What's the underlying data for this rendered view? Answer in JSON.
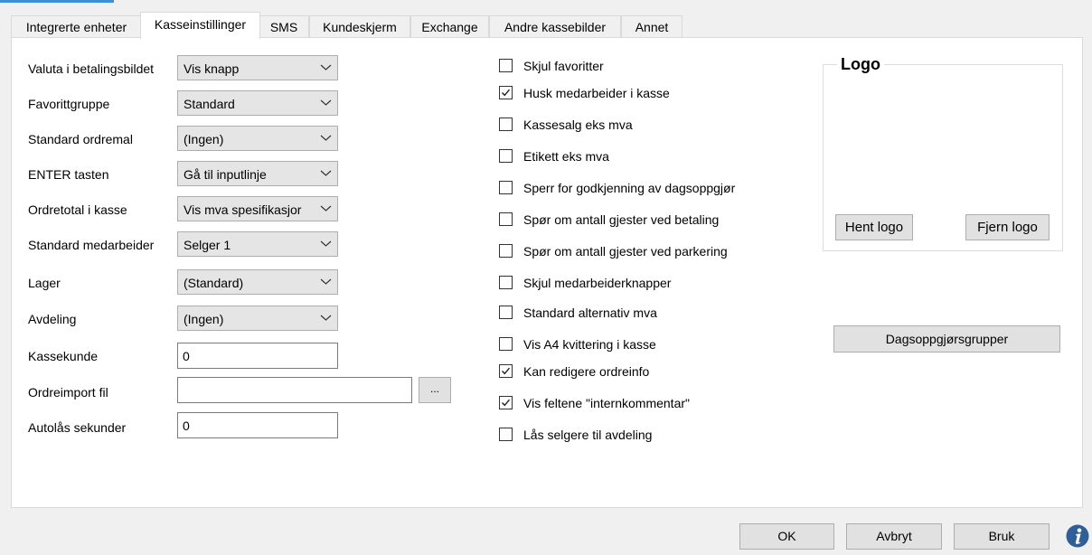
{
  "tabs": [
    {
      "label": "Integrerte enheter"
    },
    {
      "label": "Kasseinstillinger"
    },
    {
      "label": "SMS"
    },
    {
      "label": "Kundeskjerm"
    },
    {
      "label": "Exchange"
    },
    {
      "label": "Andre kassebilder"
    },
    {
      "label": "Annet"
    }
  ],
  "active_tab": "Kasseinstillinger",
  "form": {
    "valuta": {
      "label": "Valuta i betalingsbildet",
      "value": "Vis knapp"
    },
    "favorittgruppe": {
      "label": "Favorittgruppe",
      "value": "Standard"
    },
    "ordremal": {
      "label": "Standard ordremal",
      "value": "(Ingen)"
    },
    "enter": {
      "label": "ENTER tasten",
      "value": "Gå til inputlinje"
    },
    "ordretotal": {
      "label": "Ordretotal i kasse",
      "value": "Vis mva spesifikasjor"
    },
    "medarbeider": {
      "label": "Standard medarbeider",
      "value": "Selger 1"
    },
    "lager": {
      "label": "Lager",
      "value": "(Standard)"
    },
    "avdeling": {
      "label": "Avdeling",
      "value": "(Ingen)"
    },
    "kassekunde": {
      "label": "Kassekunde",
      "value": "0"
    },
    "ordreimport": {
      "label": "Ordreimport fil",
      "value": "",
      "browse_label": "..."
    },
    "autolas": {
      "label": "Autolås sekunder",
      "value": "0"
    }
  },
  "checkboxes": [
    {
      "label": "Skjul favoritter",
      "checked": false
    },
    {
      "label": "Husk medarbeider i kasse",
      "checked": true
    },
    {
      "label": "Kassesalg eks mva",
      "checked": false
    },
    {
      "label": "Etikett eks mva",
      "checked": false
    },
    {
      "label": "Sperr for godkjenning av dagsoppgjør",
      "checked": false
    },
    {
      "label": "Spør om antall gjester ved betaling",
      "checked": false
    },
    {
      "label": "Spør om antall gjester ved parkering",
      "checked": false
    },
    {
      "label": "Skjul medarbeiderknapper",
      "checked": false
    },
    {
      "label": "Standard alternativ mva",
      "checked": false
    },
    {
      "label": "Vis A4 kvittering i kasse",
      "checked": false
    },
    {
      "label": "Kan redigere ordreinfo",
      "checked": true
    },
    {
      "label": "Vis feltene \"internkommentar\"",
      "checked": true
    },
    {
      "label": "Lås selgere til avdeling",
      "checked": false
    }
  ],
  "logo": {
    "title": "Logo",
    "hent_label": "Hent logo",
    "fjern_label": "Fjern logo"
  },
  "dagsoppgjor_label": "Dagsoppgjørsgrupper",
  "footer": {
    "ok_label": "OK",
    "cancel_label": "Avbryt",
    "apply_label": "Bruk"
  },
  "colors": {
    "accent": "#3d8fd8",
    "info_icon": "#2f5f96"
  }
}
